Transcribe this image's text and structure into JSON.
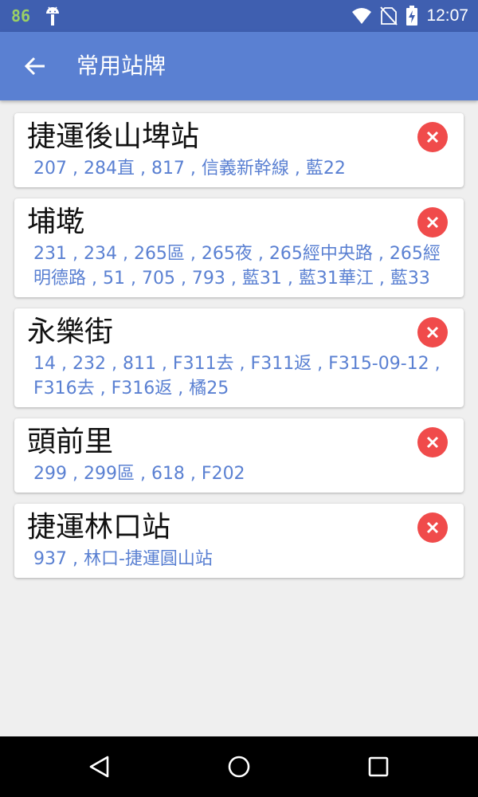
{
  "status_bar": {
    "badge": "86",
    "time": "12:07"
  },
  "app_bar": {
    "title": "常用站牌",
    "back_icon": "arrow-left-icon"
  },
  "stops": [
    {
      "name": "捷運後山埤站",
      "routes": "207 , 284直 , 817 , 信義新幹線 , 藍22"
    },
    {
      "name": "埔墘",
      "routes": "231 , 234 , 265區 , 265夜 , 265經中央路 , 265經明德路 , 51 , 705 , 793 , 藍31 , 藍31華江 , 藍33"
    },
    {
      "name": "永樂街",
      "routes": "14 , 232 , 811 , F311去 , F311返 , F315-09-12 , F316去 , F316返 , 橘25"
    },
    {
      "name": "頭前里",
      "routes": "299 , 299區 , 618 , F202"
    },
    {
      "name": "捷運林口站",
      "routes": "937 , 林口-捷運圓山站"
    }
  ],
  "colors": {
    "status_bar": "#3f5fb0",
    "app_bar": "#5a80d2",
    "route_text": "#5a80d2",
    "delete": "#f04b4b",
    "background": "#efefef"
  }
}
